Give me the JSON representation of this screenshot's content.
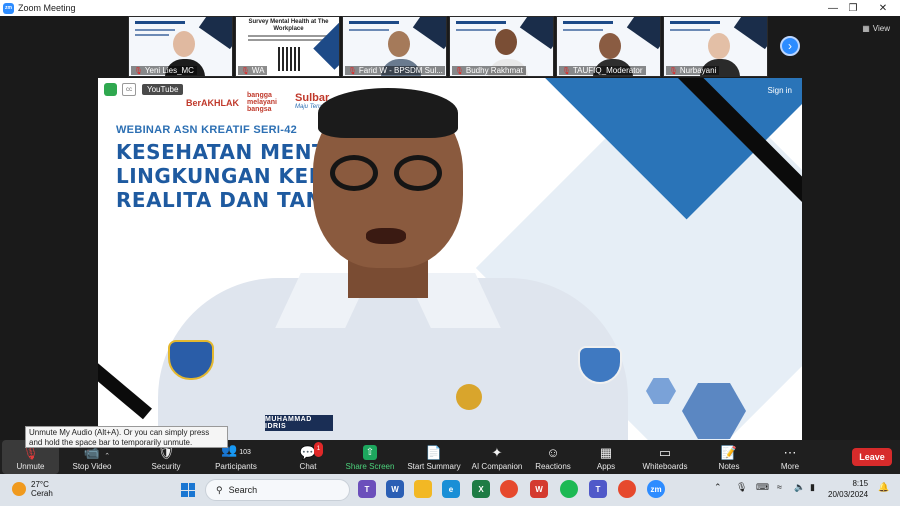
{
  "window": {
    "title": "Zoom Meeting",
    "app_icon_text": "zm"
  },
  "view_button": {
    "label": "View"
  },
  "participants_strip": [
    {
      "name": "Yeni Lies_MC",
      "muted": true
    },
    {
      "name": "WA",
      "muted": true
    },
    {
      "name": "Farid W - BPSDM Sul...",
      "muted": true
    },
    {
      "name": "Budhy Rakhmat",
      "muted": true
    },
    {
      "name": "TAUFIQ_Moderator",
      "muted": true
    },
    {
      "name": "Nurbayani",
      "muted": true
    }
  ],
  "survey_thumb": {
    "title": "Survey Mental Health at The Workplace"
  },
  "main_video": {
    "youtube_label": "YouTube",
    "sign_in": "Sign in",
    "logo_text_1": "BerAKHLAK",
    "logo_text_2": "bangga melayani bangsa",
    "logo_text_3": "Sulbar",
    "logo_text_3b": "Maju Terus",
    "webinar_label": "WEBINAR ASN KREATIF SERI-42",
    "title_lines": [
      "KESEHATAN MENTAL D",
      "LINGKUNGAN KERJA:",
      "REALITA DAN TANTAN"
    ],
    "nametag": "MUHAMMAD IDRIS"
  },
  "tooltip": {
    "text": "Unmute My Audio (Alt+A). Or you can simply press and hold the space bar to temporarily unmute."
  },
  "toolbar": {
    "unmute": "Unmute",
    "stop_video": "Stop Video",
    "security": "Security",
    "participants": "Participants",
    "participants_count": "103",
    "chat": "Chat",
    "chat_badge": "1",
    "share_screen": "Share Screen",
    "start_summary": "Start Summary",
    "ai_companion": "AI Companion",
    "reactions": "Reactions",
    "apps": "Apps",
    "whiteboards": "Whiteboards",
    "notes": "Notes",
    "more": "More",
    "leave": "Leave"
  },
  "taskbar": {
    "weather_temp": "27°C",
    "weather_desc": "Cerah",
    "search_label": "Search",
    "time": "8:15",
    "date": "20/03/2024"
  }
}
